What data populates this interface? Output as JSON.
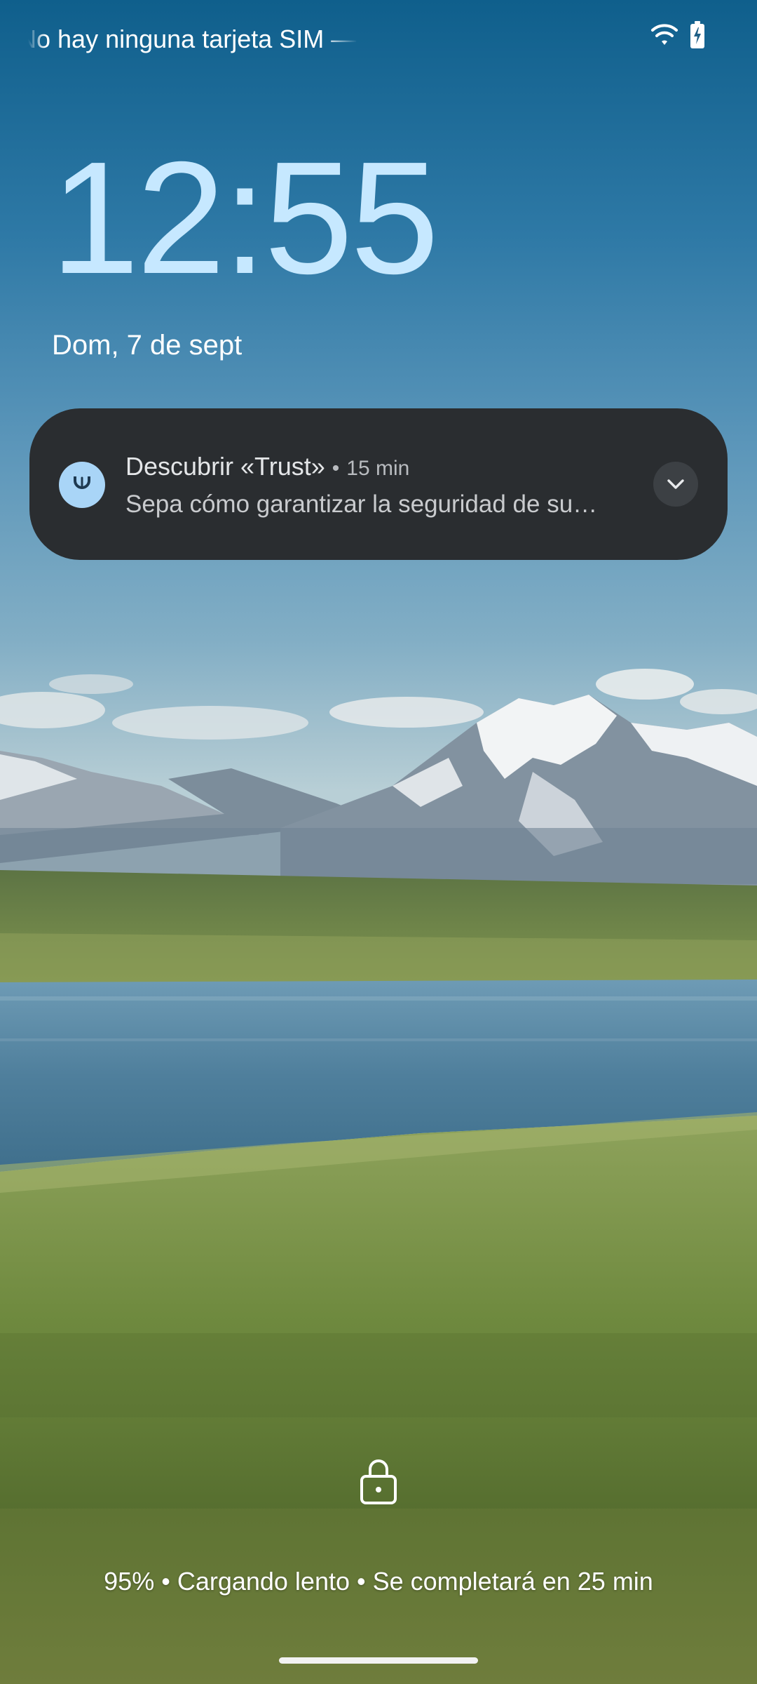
{
  "status_bar": {
    "carrier_text": "No hay ninguna tarjeta SIM — Solo llamadas de emergencia",
    "icons": [
      "wifi-icon",
      "battery-charging-icon"
    ]
  },
  "lockscreen": {
    "time": "12:55",
    "date": "Dom, 7 de sept"
  },
  "notification": {
    "app_icon": "trust-icon",
    "title": "Descubrir «Trust»",
    "separator": "•",
    "time": "15 min",
    "text": "Sepa cómo garantizar la seguridad de su…",
    "expand_icon": "chevron-down-icon"
  },
  "bottom": {
    "lock_icon": "lock-icon",
    "charging_text": "95% • Cargando lento • Se completará en 25 min"
  },
  "colors": {
    "clock": "#c6e8ff",
    "notification_background": "#2a2d30",
    "app_icon_background": "#a9d5f7"
  }
}
